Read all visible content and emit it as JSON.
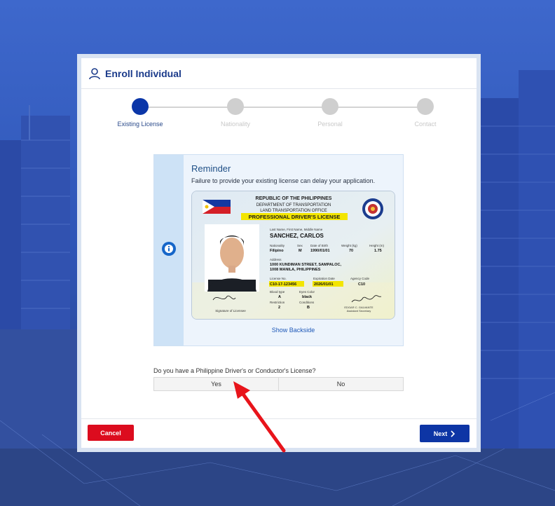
{
  "modal": {
    "title": "Enroll Individual"
  },
  "steps": [
    {
      "label": "Existing License",
      "active": true
    },
    {
      "label": "Nationality",
      "active": false
    },
    {
      "label": "Personal",
      "active": false
    },
    {
      "label": "Contact",
      "active": false
    }
  ],
  "reminder": {
    "title": "Reminder",
    "text": "Failure to provide your existing license can delay your application.",
    "show_backside": "Show Backside"
  },
  "license_card": {
    "republic": "REPUBLIC OF THE PHILIPPINES",
    "department": "DEPARTMENT OF TRANSPORTATION",
    "office": "LAND TRANSPORTATION OFFICE",
    "type": "PROFESSIONAL DRIVER'S LICENSE",
    "name_label": "Last Name, First Name, Middle Name",
    "name": "SANCHEZ, CARLOS",
    "nationality_label": "Nationality",
    "nationality": "Filipino",
    "sex_label": "Sex",
    "sex": "M",
    "dob_label": "Date of Birth",
    "dob": "1990/01/01",
    "weight_label": "Weight (kg)",
    "weight": "70",
    "height_label": "Height (m)",
    "height": "1.75",
    "address_label": "Address",
    "address_line1": "1000 KUNDIMAN STREET, SAMPALOC,",
    "address_line2": "1008 MANILA, PHILIPPINES",
    "license_no_label": "License No.",
    "license_no": "C10-17-123456",
    "expiration_label": "Expiration Date",
    "expiration": "2026/01/01",
    "agency_label": "Agency Code",
    "agency": "C10",
    "blood_label": "Blood type",
    "blood": "A",
    "eyes_label": "Eyes Color",
    "eyes": "black",
    "restriction_label": "Restriction",
    "restriction": "2",
    "conditions_label": "Conditions",
    "conditions": "B",
    "signature_label": "Signature of Licensee",
    "official_name": "EDGAR C. GALVANTE",
    "official_title": "Assistant Secretary"
  },
  "question": {
    "text": "Do you have a Philippine Driver's or Conductor's License?",
    "yes": "Yes",
    "no": "No"
  },
  "buttons": {
    "cancel": "Cancel",
    "next": "Next"
  },
  "colors": {
    "primary": "#0d35a5",
    "danger": "#dc0c1e",
    "annotation_arrow": "#e8141b"
  }
}
